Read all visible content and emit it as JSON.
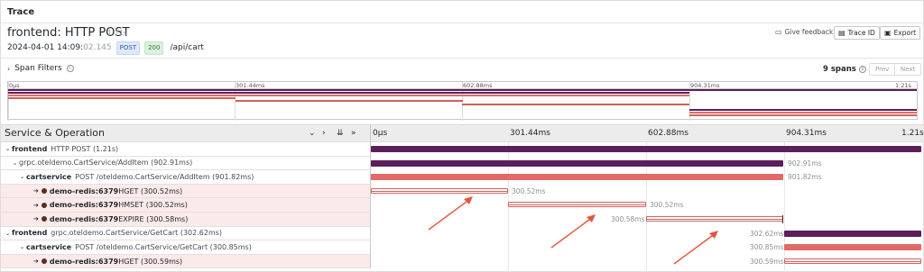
{
  "panel": {
    "title": "Trace"
  },
  "header": {
    "trace_title": "frontend: HTTP POST",
    "trace_duration": "1.21s",
    "timestamp_main": "2024-04-01 14:09:",
    "timestamp_ms": "02.145",
    "method": "POST",
    "status": "200",
    "route": "/api/cart",
    "feedback_label": "Give feedback",
    "trace_id_label": "Trace ID",
    "export_label": "Export"
  },
  "filters": {
    "label": "Span Filters",
    "spans_count": "9 spans",
    "prev_label": "Prev",
    "next_label": "Next"
  },
  "minimap": {
    "ticks": [
      "0μs",
      "301.44ms",
      "602.88ms",
      "904.31ms",
      "1.21s"
    ]
  },
  "table": {
    "head_label": "Service & Operation",
    "ticks": [
      "0μs",
      "301.44ms",
      "602.88ms",
      "904.31ms",
      "1.21s"
    ],
    "rows": [
      {
        "service": "frontend",
        "operation": "HTTP POST (1.21s)",
        "bar_label": ""
      },
      {
        "service": "",
        "operation": "grpc.oteldemo.CartService/AddItem (902.91ms)",
        "bar_label": "902.91ms"
      },
      {
        "service": "cartservice",
        "operation": "POST /oteldemo.CartService/AddItem (901.82ms)",
        "bar_label": "901.82ms"
      },
      {
        "service": "demo-redis:6379",
        "operation": "HGET (300.52ms)",
        "bar_label": "300.52ms"
      },
      {
        "service": "demo-redis:6379",
        "operation": "HMSET (300.52ms)",
        "bar_label": "300.52ms"
      },
      {
        "service": "demo-redis:6379",
        "operation": "EXPIRE (300.58ms)",
        "bar_label": "300.58ms"
      },
      {
        "service": "frontend",
        "operation": "grpc.oteldemo.CartService/GetCart (302.62ms)",
        "bar_label": "302.62ms"
      },
      {
        "service": "cartservice",
        "operation": "POST /oteldemo.CartService/GetCart (300.85ms)",
        "bar_label": "300.85ms"
      },
      {
        "service": "demo-redis:6379",
        "operation": "HGET (300.59ms)",
        "bar_label": "300.59ms"
      }
    ]
  },
  "colors": {
    "frontend": "#5b1f5b",
    "cartservice": "#e06a66",
    "redis": "#d5605c",
    "highlight": "#f7d9d9",
    "annotation": "#e8553a"
  }
}
